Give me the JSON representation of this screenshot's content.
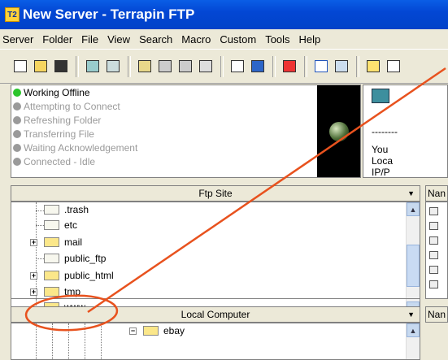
{
  "window": {
    "title": "New Server - Terrapin FTP",
    "icon_text": "T2"
  },
  "menu": [
    "Server",
    "Folder",
    "File",
    "View",
    "Search",
    "Macro",
    "Custom",
    "Tools",
    "Help"
  ],
  "status": {
    "items": [
      {
        "label": "Working Offline",
        "active": true
      },
      {
        "label": "Attempting to Connect",
        "active": false
      },
      {
        "label": "Refreshing Folder",
        "active": false
      },
      {
        "label": "Transferring File",
        "active": false
      },
      {
        "label": "Waiting Acknowledgement",
        "active": false
      },
      {
        "label": "Connected - Idle",
        "active": false
      }
    ]
  },
  "right_info": {
    "line1": "--------",
    "line2": "You",
    "line3": "Loca",
    "line4": "IP/P"
  },
  "ftp_site": {
    "header": "Ftp Site",
    "folders": [
      ".trash",
      "etc",
      "mail",
      "public_ftp",
      "public_html",
      "tmp",
      "www"
    ]
  },
  "right_panel": {
    "name_header": "Nan",
    "name_header2": "Nan"
  },
  "local_computer": {
    "header": "Local Computer",
    "folders": [
      "ebay"
    ]
  },
  "colors": {
    "accent": "#0347d4",
    "annotation": "#e8521e",
    "status_active": "#2cc52c"
  }
}
